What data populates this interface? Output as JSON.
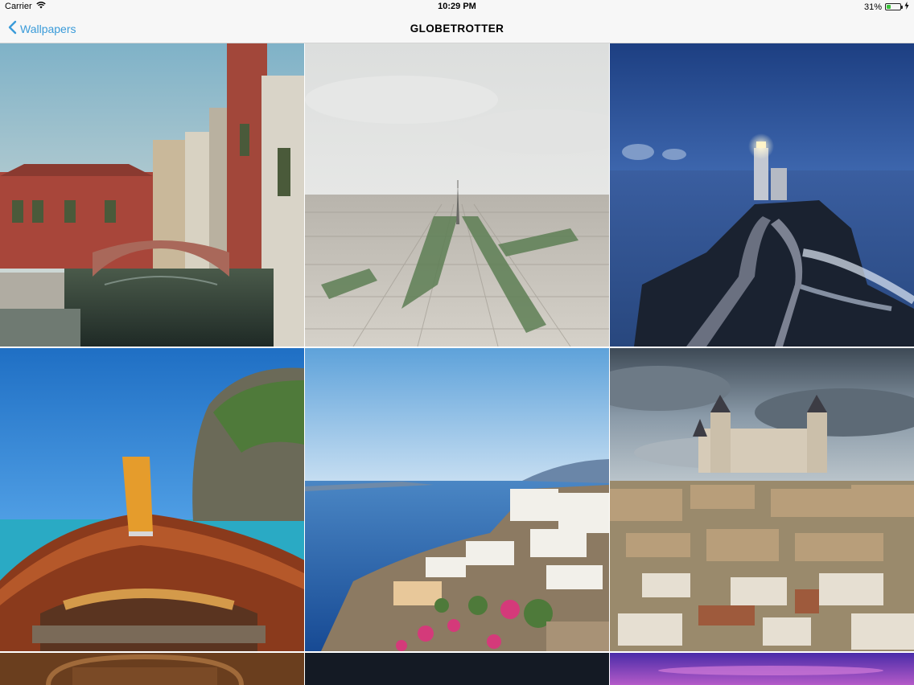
{
  "status_bar": {
    "carrier": "Carrier",
    "time": "10:29 PM",
    "battery": "31%",
    "battery_level": 0.31,
    "icons": [
      "wifi-icon",
      "battery-icon",
      "charging-bolt-icon"
    ]
  },
  "nav": {
    "back_label": "Wallpapers",
    "back_icon": "chevron-left-icon",
    "title": "GLOBETROTTER",
    "accent_color": "#3a9bd9"
  },
  "wallpapers": [
    "venice-canal-bridge",
    "paris-eiffel-tower-aerial",
    "lighthouse-stone-causeway",
    "thai-longtail-boat-cliffs",
    "santorini-coast-houses",
    "toledo-alcazar-cityscape",
    "carved-wooden-door",
    "dark-night-sky",
    "purple-sunset-sky"
  ]
}
